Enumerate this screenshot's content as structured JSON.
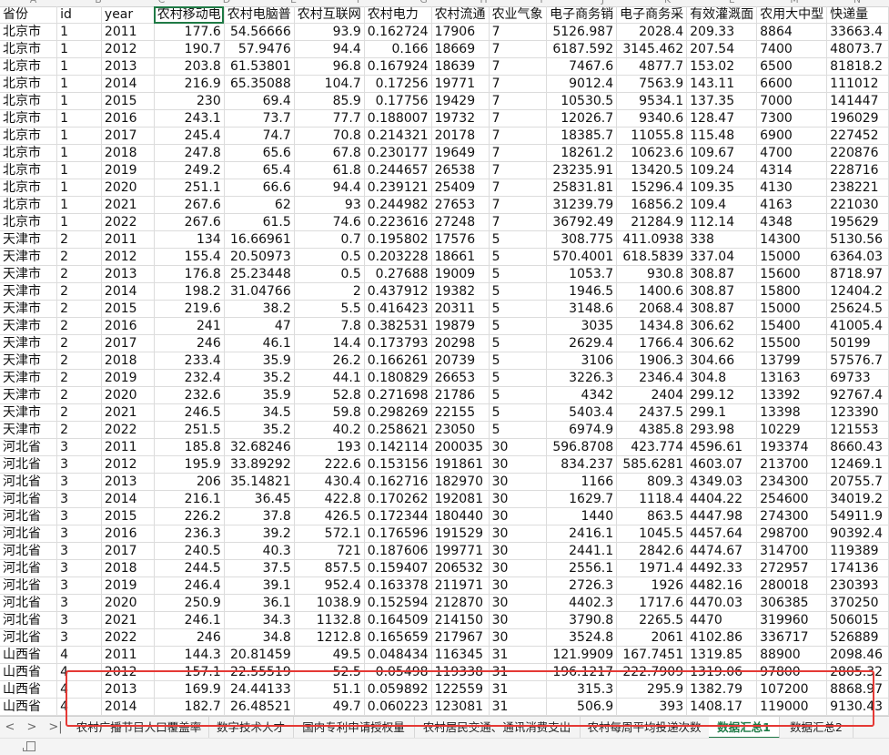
{
  "columns": [
    "A",
    "B",
    "C",
    "D",
    "E",
    "F",
    "G",
    "H",
    "I",
    "J",
    "K",
    "L",
    "M",
    "N"
  ],
  "header_row": [
    "省份",
    "id",
    "year",
    "农村移动电",
    "农村电脑普",
    "农村互联网",
    "农村电力",
    "农村流通",
    "农业气象",
    "电子商务销",
    "电子商务采",
    "有效灌溉面",
    "农用大中型",
    "快递量"
  ],
  "rows": [
    [
      "北京市",
      "1",
      "2011",
      "177.6",
      "54.56666",
      "93.9",
      "0.162724",
      "17906",
      "7",
      "5126.987",
      "2028.4",
      "209.33",
      "8864",
      "33663.4"
    ],
    [
      "北京市",
      "1",
      "2012",
      "190.7",
      "57.9476",
      "94.4",
      "0.166",
      "18669",
      "7",
      "6187.592",
      "3145.462",
      "207.54",
      "7400",
      "48073.7"
    ],
    [
      "北京市",
      "1",
      "2013",
      "203.8",
      "61.53801",
      "96.8",
      "0.167924",
      "18639",
      "7",
      "7467.6",
      "4877.7",
      "153.02",
      "6500",
      "81818.2"
    ],
    [
      "北京市",
      "1",
      "2014",
      "216.9",
      "65.35088",
      "104.7",
      "0.17256",
      "19771",
      "7",
      "9012.4",
      "7563.9",
      "143.11",
      "6600",
      "111012"
    ],
    [
      "北京市",
      "1",
      "2015",
      "230",
      "69.4",
      "85.9",
      "0.17756",
      "19429",
      "7",
      "10530.5",
      "9534.1",
      "137.35",
      "7000",
      "141447"
    ],
    [
      "北京市",
      "1",
      "2016",
      "243.1",
      "73.7",
      "77.7",
      "0.188007",
      "19732",
      "7",
      "12026.7",
      "9340.6",
      "128.47",
      "7300",
      "196029"
    ],
    [
      "北京市",
      "1",
      "2017",
      "245.4",
      "74.7",
      "70.8",
      "0.214321",
      "20178",
      "7",
      "18385.7",
      "11055.8",
      "115.48",
      "6900",
      "227452"
    ],
    [
      "北京市",
      "1",
      "2018",
      "247.8",
      "65.6",
      "67.8",
      "0.230177",
      "19649",
      "7",
      "18261.2",
      "10623.6",
      "109.67",
      "4700",
      "220876"
    ],
    [
      "北京市",
      "1",
      "2019",
      "249.2",
      "65.4",
      "61.8",
      "0.244657",
      "26538",
      "7",
      "23235.91",
      "13420.5",
      "109.24",
      "4314",
      "228716"
    ],
    [
      "北京市",
      "1",
      "2020",
      "251.1",
      "66.6",
      "94.4",
      "0.239121",
      "25409",
      "7",
      "25831.81",
      "15296.4",
      "109.35",
      "4130",
      "238221"
    ],
    [
      "北京市",
      "1",
      "2021",
      "267.6",
      "62",
      "93",
      "0.244982",
      "27653",
      "7",
      "31239.79",
      "16856.2",
      "109.4",
      "4163",
      "221030"
    ],
    [
      "北京市",
      "1",
      "2022",
      "267.6",
      "61.5",
      "74.6",
      "0.223616",
      "27248",
      "7",
      "36792.49",
      "21284.9",
      "112.14",
      "4348",
      "195629"
    ],
    [
      "天津市",
      "2",
      "2011",
      "134",
      "16.66961",
      "0.7",
      "0.195802",
      "17576",
      "5",
      "308.775",
      "411.0938",
      "338",
      "14300",
      "5130.56"
    ],
    [
      "天津市",
      "2",
      "2012",
      "155.4",
      "20.50973",
      "0.5",
      "0.203228",
      "18661",
      "5",
      "570.4001",
      "618.5839",
      "337.04",
      "15000",
      "6364.03"
    ],
    [
      "天津市",
      "2",
      "2013",
      "176.8",
      "25.23448",
      "0.5",
      "0.27688",
      "19009",
      "5",
      "1053.7",
      "930.8",
      "308.87",
      "15600",
      "8718.97"
    ],
    [
      "天津市",
      "2",
      "2014",
      "198.2",
      "31.04766",
      "2",
      "0.437912",
      "19382",
      "5",
      "1946.5",
      "1400.6",
      "308.87",
      "15800",
      "12404.2"
    ],
    [
      "天津市",
      "2",
      "2015",
      "219.6",
      "38.2",
      "5.5",
      "0.416423",
      "20311",
      "5",
      "3148.6",
      "2068.4",
      "308.87",
      "15000",
      "25624.5"
    ],
    [
      "天津市",
      "2",
      "2016",
      "241",
      "47",
      "7.8",
      "0.382531",
      "19879",
      "5",
      "3035",
      "1434.8",
      "306.62",
      "15400",
      "41005.4"
    ],
    [
      "天津市",
      "2",
      "2017",
      "246",
      "46.1",
      "14.4",
      "0.173793",
      "20298",
      "5",
      "2629.4",
      "1766.4",
      "306.62",
      "15500",
      "50199"
    ],
    [
      "天津市",
      "2",
      "2018",
      "233.4",
      "35.9",
      "26.2",
      "0.166261",
      "20739",
      "5",
      "3106",
      "1906.3",
      "304.66",
      "13799",
      "57576.7"
    ],
    [
      "天津市",
      "2",
      "2019",
      "232.4",
      "35.2",
      "44.1",
      "0.180829",
      "26653",
      "5",
      "3226.3",
      "2346.4",
      "304.8",
      "13163",
      "69733"
    ],
    [
      "天津市",
      "2",
      "2020",
      "232.6",
      "35.9",
      "52.8",
      "0.271698",
      "21786",
      "5",
      "4342",
      "2404",
      "299.12",
      "13392",
      "92767.4"
    ],
    [
      "天津市",
      "2",
      "2021",
      "246.5",
      "34.5",
      "59.8",
      "0.298269",
      "22155",
      "5",
      "5403.4",
      "2437.5",
      "299.1",
      "13398",
      "123390"
    ],
    [
      "天津市",
      "2",
      "2022",
      "251.5",
      "35.2",
      "40.2",
      "0.258621",
      "23050",
      "5",
      "6974.9",
      "4385.8",
      "293.98",
      "10229",
      "121553"
    ],
    [
      "河北省",
      "3",
      "2011",
      "185.8",
      "32.68246",
      "193",
      "0.142114",
      "200035",
      "30",
      "596.8708",
      "423.774",
      "4596.61",
      "193374",
      "8660.43"
    ],
    [
      "河北省",
      "3",
      "2012",
      "195.9",
      "33.89292",
      "222.6",
      "0.153156",
      "191861",
      "30",
      "834.237",
      "585.6281",
      "4603.07",
      "213700",
      "12469.1"
    ],
    [
      "河北省",
      "3",
      "2013",
      "206",
      "35.14821",
      "430.4",
      "0.162716",
      "182970",
      "30",
      "1166",
      "809.3",
      "4349.03",
      "234300",
      "20755.7"
    ],
    [
      "河北省",
      "3",
      "2014",
      "216.1",
      "36.45",
      "422.8",
      "0.170262",
      "192081",
      "30",
      "1629.7",
      "1118.4",
      "4404.22",
      "254600",
      "34019.2"
    ],
    [
      "河北省",
      "3",
      "2015",
      "226.2",
      "37.8",
      "426.5",
      "0.172344",
      "180440",
      "30",
      "1440",
      "863.5",
      "4447.98",
      "274300",
      "54911.9"
    ],
    [
      "河北省",
      "3",
      "2016",
      "236.3",
      "39.2",
      "572.1",
      "0.176596",
      "191529",
      "30",
      "2416.1",
      "1045.5",
      "4457.64",
      "298700",
      "90392.4"
    ],
    [
      "河北省",
      "3",
      "2017",
      "240.5",
      "40.3",
      "721",
      "0.187606",
      "199771",
      "30",
      "2441.1",
      "2842.6",
      "4474.67",
      "314700",
      "119389"
    ],
    [
      "河北省",
      "3",
      "2018",
      "244.5",
      "37.5",
      "857.5",
      "0.159407",
      "206532",
      "30",
      "2556.1",
      "1971.4",
      "4492.33",
      "272957",
      "174136"
    ],
    [
      "河北省",
      "3",
      "2019",
      "246.4",
      "39.1",
      "952.4",
      "0.163378",
      "211971",
      "30",
      "2726.3",
      "1926",
      "4482.16",
      "280018",
      "230393"
    ],
    [
      "河北省",
      "3",
      "2020",
      "250.9",
      "36.1",
      "1038.9",
      "0.152594",
      "212870",
      "30",
      "4402.3",
      "1717.6",
      "4470.03",
      "306385",
      "370250"
    ],
    [
      "河北省",
      "3",
      "2021",
      "246.1",
      "34.3",
      "1132.8",
      "0.164509",
      "214150",
      "30",
      "3790.8",
      "2265.5",
      "4470",
      "319960",
      "506015"
    ],
    [
      "河北省",
      "3",
      "2022",
      "246",
      "34.8",
      "1212.8",
      "0.165659",
      "217967",
      "30",
      "3524.8",
      "2061",
      "4102.86",
      "336717",
      "526889"
    ],
    [
      "山西省",
      "4",
      "2011",
      "144.3",
      "20.81459",
      "49.5",
      "0.048434",
      "116345",
      "31",
      "121.9909",
      "167.7451",
      "1319.85",
      "88900",
      "2098.46"
    ],
    [
      "山西省",
      "4",
      "2012",
      "157.1",
      "22.55519",
      "52.5",
      "0.05498",
      "119338",
      "31",
      "196.1217",
      "222.7909",
      "1319.06",
      "97800",
      "2805.32"
    ],
    [
      "山西省",
      "4",
      "2013",
      "169.9",
      "24.44133",
      "51.1",
      "0.059892",
      "122559",
      "31",
      "315.3",
      "295.9",
      "1382.79",
      "107200",
      "8868.97"
    ],
    [
      "山西省",
      "4",
      "2014",
      "182.7",
      "26.48521",
      "49.7",
      "0.060223",
      "123081",
      "31",
      "506.9",
      "393",
      "1408.17",
      "119000",
      "9130.43"
    ]
  ],
  "sheet_tabs": [
    "农村广播节目人口覆盖率",
    "数字技术人才",
    "国内专利申请授权量",
    "农村居民交通、通讯消费支出",
    "农村每周平均投递次数",
    "数据汇总1",
    "数据汇总2"
  ],
  "active_tab": "数据汇总1",
  "tab_nav": [
    "<",
    ">",
    ">|"
  ],
  "tab_more": "···",
  "colors": {
    "active_tab": "#1e7a46",
    "selection": "#1f7a45",
    "highlight_box": "#e53935"
  }
}
